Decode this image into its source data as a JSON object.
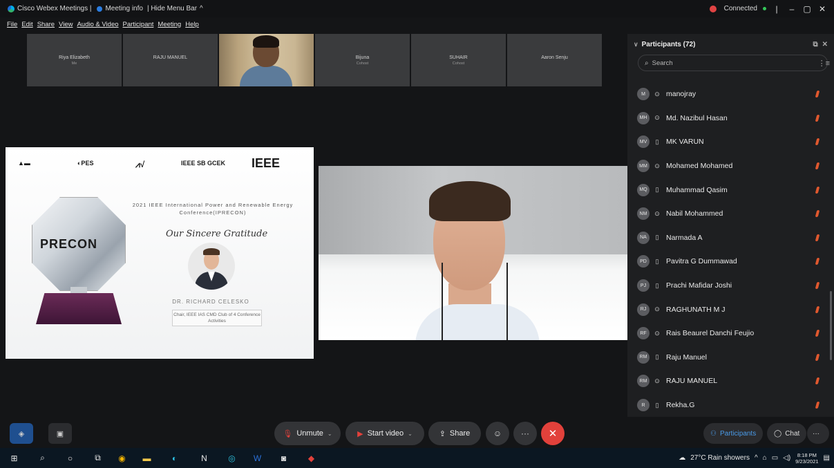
{
  "window": {
    "app_title": "Cisco Webex Meetings |",
    "meeting_info": "Meeting info",
    "hide_menu_bar": "| Hide Menu Bar",
    "connection_status": "Connected"
  },
  "menu": [
    "File",
    "Edit",
    "Share",
    "View",
    "Audio & Video",
    "Participant",
    "Meeting",
    "Help"
  ],
  "thumbnails": [
    {
      "name": "Riya Elizabeth",
      "sub": "Me",
      "video": false
    },
    {
      "name": "RAJU MANUEL",
      "sub": "",
      "video": false
    },
    {
      "name": "",
      "sub": "",
      "video": true
    },
    {
      "name": "Bijuna",
      "sub": "Cohost",
      "video": false
    },
    {
      "name": "SUHAIR",
      "sub": "Cohost",
      "video": false
    },
    {
      "name": "Aaron Senju",
      "sub": "",
      "video": false
    }
  ],
  "slide": {
    "logos": [
      "IEEE SB GCEK",
      "IEEE"
    ],
    "conference_title": "2021 IEEE International Power and Renewable Energy Conference(IPRECON)",
    "gratitude": "Our Sincere Gratitude",
    "speaker": "DR. RICHARD CELESKO",
    "role": "Chair, IEEE IAS CMD Club of 4 Conference Activities",
    "trophy_label": "PRECON"
  },
  "participants_panel": {
    "title": "Participants (72)",
    "search_placeholder": "Search",
    "participants": [
      {
        "initials": "M",
        "name": "manojray",
        "device": "headset"
      },
      {
        "initials": "MH",
        "name": "Md. Nazibul Hasan",
        "device": "headset"
      },
      {
        "initials": "MV",
        "name": "MK VARUN",
        "device": "phone"
      },
      {
        "initials": "MM",
        "name": "Mohamed Mohamed",
        "device": "headset"
      },
      {
        "initials": "MQ",
        "name": "Muhammad Qasim",
        "device": "phone"
      },
      {
        "initials": "NM",
        "name": "Nabil Mohammed",
        "device": "headset"
      },
      {
        "initials": "NA",
        "name": "Narmada A",
        "device": "phone"
      },
      {
        "initials": "PD",
        "name": "Pavitra G Dummawad",
        "device": "phone"
      },
      {
        "initials": "PJ",
        "name": "Prachi Mafidar Joshi",
        "device": "phone"
      },
      {
        "initials": "RJ",
        "name": "RAGHUNATH M J",
        "device": "headset"
      },
      {
        "initials": "RF",
        "name": "Rais Beaurel Danchi Feujio",
        "device": "headset"
      },
      {
        "initials": "RM",
        "name": "Raju Manuel",
        "device": "phone"
      },
      {
        "initials": "RM",
        "name": "RAJU MANUEL",
        "device": "headset"
      },
      {
        "initials": "R",
        "name": "Rekha.G",
        "device": "phone"
      }
    ]
  },
  "controls": {
    "unmute": "Unmute",
    "start_video": "Start video",
    "share": "Share",
    "participants": "Participants",
    "chat": "Chat"
  },
  "taskbar": {
    "weather": "27°C  Rain showers",
    "time": "8:18 PM",
    "date": "9/23/2021"
  },
  "colors": {
    "leave_red": "#e2413b",
    "mic_muted": "#e0582e",
    "active_tab": "#4a9be8"
  }
}
